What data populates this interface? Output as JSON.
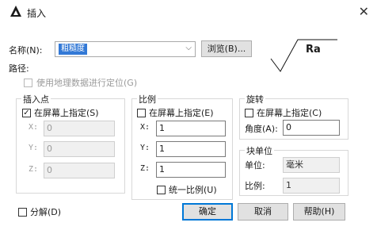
{
  "window": {
    "title": "插入",
    "close_glyph": "✕"
  },
  "name_row": {
    "label": "名称(N):",
    "value": "粗糙度",
    "arrow": "⌵",
    "browse_label": "浏览(B)..."
  },
  "path": {
    "label": "路径:",
    "geo_checkbox_label": "使用地理数据进行定位(G)"
  },
  "preview": {
    "symbol_text": "Ra"
  },
  "insert_point": {
    "title": "插入点",
    "specify_label": "在屏幕上指定(S)",
    "specify_checked": true,
    "check_glyph": "✓",
    "x_label": "X:",
    "x_value": "0",
    "y_label": "Y:",
    "y_value": "0",
    "z_label": "Z:",
    "z_value": "0"
  },
  "scale": {
    "title": "比例",
    "specify_label": "在屏幕上指定(E)",
    "x_label": "X:",
    "x_value": "1",
    "y_label": "Y:",
    "y_value": "1",
    "z_label": "Z:",
    "z_value": "1",
    "uniform_label": "统一比例(U)"
  },
  "rotation": {
    "title": "旋转",
    "specify_label": "在屏幕上指定(C)",
    "angle_label": "角度(A):",
    "angle_value": "0"
  },
  "block_unit": {
    "title": "块单位",
    "unit_label": "单位:",
    "unit_value": "毫米",
    "factor_label": "比例:",
    "factor_value": "1"
  },
  "footer": {
    "explode_label": "分解(D)",
    "ok_label": "确定",
    "cancel_label": "取消",
    "help_label": "帮助(H)"
  },
  "colors": {
    "accent": "#0078d7",
    "selection": "#3379d6"
  }
}
